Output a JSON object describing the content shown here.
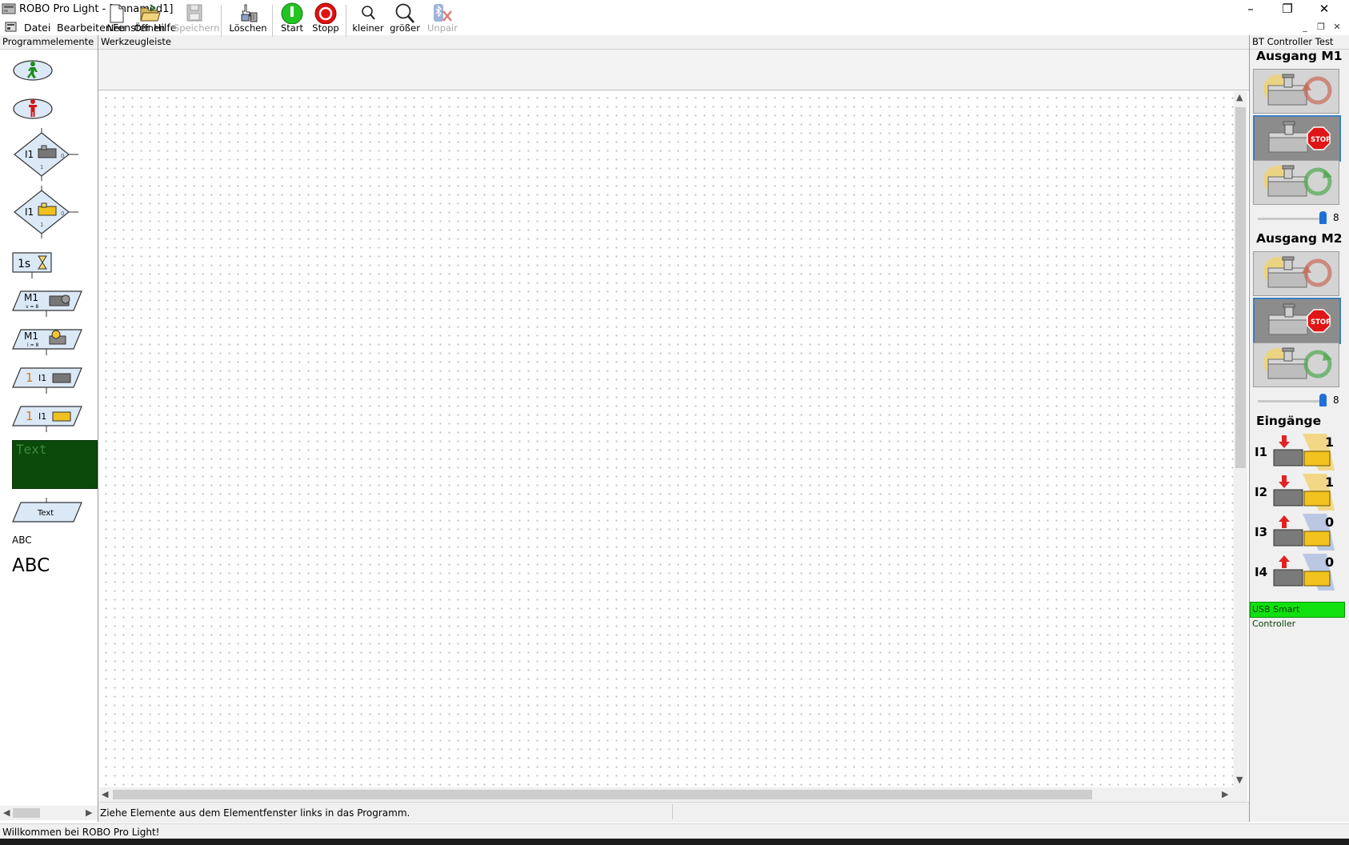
{
  "window": {
    "title": "ROBO Pro Light - [unnamed1]",
    "controls": {
      "minimize": "–",
      "maximize": "❐",
      "close": "✕"
    }
  },
  "menu": [
    "Datei",
    "Bearbeiten",
    "Fenster",
    "Hilfe"
  ],
  "mdi_controls": {
    "minimize": "_",
    "restore": "❐",
    "close": "✕"
  },
  "left_panel": {
    "header": "Programmelemente",
    "palette": {
      "branch_input_label": "I1",
      "branch_port_0": "0",
      "branch_port_1": "1",
      "wait_label": "1s",
      "motor_label": "M1",
      "motor_speed_sub": "v = 8",
      "motor_lamp_sub": "i = 8",
      "wait_input_count": "1",
      "wait_input_label": "I1",
      "display_label": "Text",
      "message_label": "Text",
      "text_small": "ABC",
      "text_large": "ABC"
    }
  },
  "toolbar": {
    "header": "Werkzeugleiste",
    "buttons": {
      "new": "Neu",
      "open": "Öffnen",
      "save": "Speichern",
      "delete": "Löschen",
      "start": "Start",
      "stop": "Stopp",
      "zoom_out": "kleiner",
      "zoom_in": "größer",
      "unpair": "Unpair"
    }
  },
  "status": {
    "hint": "Ziehe Elemente aus dem Elementfenster links in das Programm.",
    "message": "Willkommen bei ROBO Pro Light!"
  },
  "right_panel": {
    "header": "BT Controller Test",
    "output_m1": {
      "title": "Ausgang M1",
      "speed": "8",
      "selected": "stop"
    },
    "output_m2": {
      "title": "Ausgang M2",
      "speed": "8",
      "selected": "stop"
    },
    "inputs": {
      "title": "Eingänge",
      "items": [
        {
          "label": "I1",
          "value": "1"
        },
        {
          "label": "I2",
          "value": "1"
        },
        {
          "label": "I3",
          "value": "0"
        },
        {
          "label": "I4",
          "value": "0"
        }
      ]
    },
    "controller_status": "USB Smart Controller"
  },
  "colors": {
    "start_green": "#22c322",
    "stop_red": "#e01010",
    "display_bg": "#0b4a0b",
    "usb_badge": "#11e011",
    "selected_border": "#3d7fbf"
  }
}
